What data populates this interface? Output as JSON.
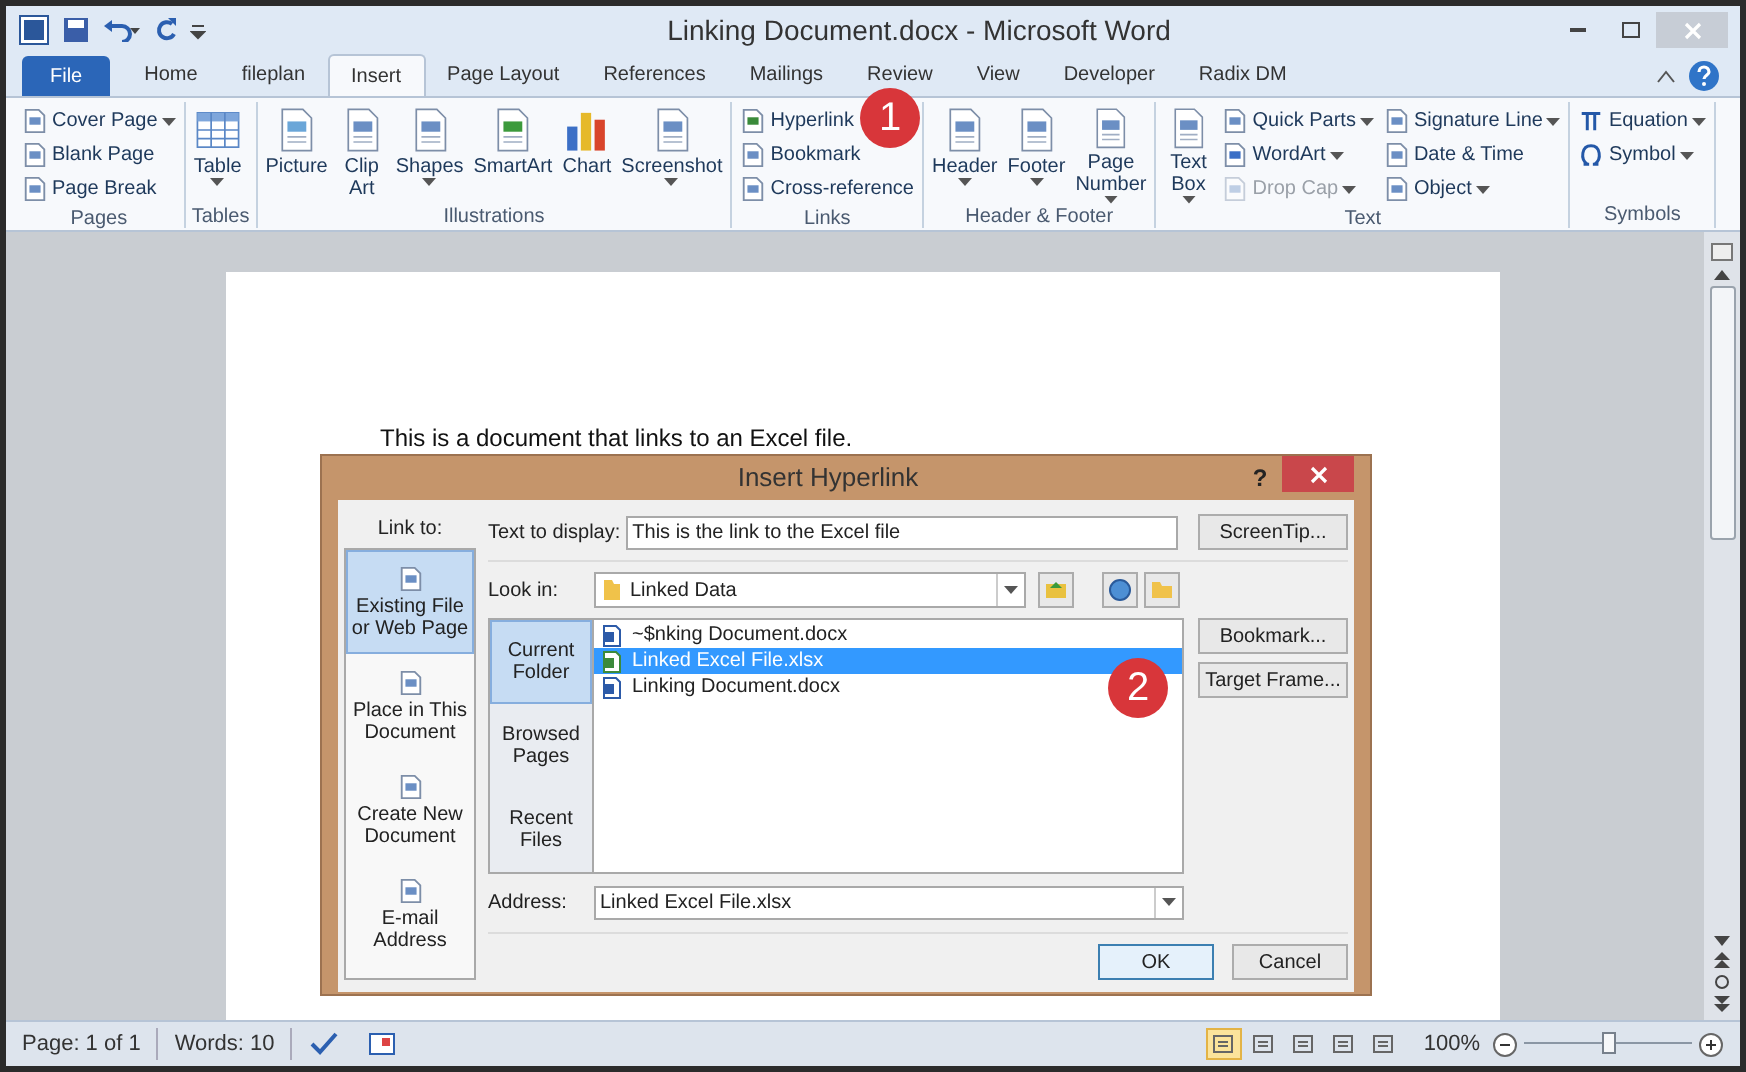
{
  "window": {
    "title": "Linking Document.docx - Microsoft Word"
  },
  "tabs": [
    {
      "label": "File",
      "kind": "file",
      "selected": false
    },
    {
      "label": "Home",
      "kind": "tab",
      "selected": false
    },
    {
      "label": "fileplan",
      "kind": "tab",
      "selected": false
    },
    {
      "label": "Insert",
      "kind": "tab",
      "selected": true
    },
    {
      "label": "Page Layout",
      "kind": "tab",
      "selected": false
    },
    {
      "label": "References",
      "kind": "tab",
      "selected": false
    },
    {
      "label": "Mailings",
      "kind": "tab",
      "selected": false
    },
    {
      "label": "Review",
      "kind": "tab",
      "selected": false
    },
    {
      "label": "View",
      "kind": "tab",
      "selected": false
    },
    {
      "label": "Developer",
      "kind": "tab",
      "selected": false
    },
    {
      "label": "Radix DM",
      "kind": "tab",
      "selected": false
    }
  ],
  "ribbon": [
    {
      "label": "Pages",
      "items": [
        {
          "kind": "small",
          "label": "Cover Page",
          "dropdown": true,
          "disabled": false
        },
        {
          "kind": "small",
          "label": "Blank Page",
          "dropdown": false,
          "disabled": false
        },
        {
          "kind": "small",
          "label": "Page Break",
          "dropdown": false,
          "disabled": false
        }
      ]
    },
    {
      "label": "Tables",
      "items": [
        {
          "kind": "large",
          "label": "Table",
          "dropdown": true,
          "disabled": false
        }
      ]
    },
    {
      "label": "Illustrations",
      "items": [
        {
          "kind": "large",
          "label": "Picture",
          "dropdown": false,
          "disabled": false
        },
        {
          "kind": "large",
          "label": "Clip\nArt",
          "dropdown": false,
          "disabled": false
        },
        {
          "kind": "large",
          "label": "Shapes",
          "dropdown": true,
          "disabled": false
        },
        {
          "kind": "large",
          "label": "SmartArt",
          "dropdown": false,
          "disabled": false
        },
        {
          "kind": "large",
          "label": "Chart",
          "dropdown": false,
          "disabled": false
        },
        {
          "kind": "large",
          "label": "Screenshot",
          "dropdown": true,
          "disabled": false
        }
      ]
    },
    {
      "label": "Links",
      "items": [
        {
          "kind": "small",
          "label": "Hyperlink",
          "dropdown": false,
          "disabled": false
        },
        {
          "kind": "small",
          "label": "Bookmark",
          "dropdown": false,
          "disabled": false
        },
        {
          "kind": "small",
          "label": "Cross-reference",
          "dropdown": false,
          "disabled": false
        }
      ]
    },
    {
      "label": "Header & Footer",
      "items": [
        {
          "kind": "large",
          "label": "Header",
          "dropdown": true,
          "disabled": false
        },
        {
          "kind": "large",
          "label": "Footer",
          "dropdown": true,
          "disabled": false
        },
        {
          "kind": "large",
          "label": "Page\nNumber",
          "dropdown": true,
          "disabled": false
        }
      ]
    },
    {
      "label": "Text",
      "items": [
        {
          "kind": "large",
          "label": "Text\nBox",
          "dropdown": true,
          "disabled": false
        },
        {
          "kind": "small",
          "label": "Quick Parts",
          "dropdown": true,
          "disabled": false
        },
        {
          "kind": "small",
          "label": "WordArt",
          "dropdown": true,
          "disabled": false
        },
        {
          "kind": "small",
          "label": "Drop Cap",
          "dropdown": true,
          "disabled": true
        },
        {
          "kind": "small",
          "label": "Signature Line",
          "dropdown": true,
          "disabled": false
        },
        {
          "kind": "small",
          "label": "Date & Time",
          "dropdown": false,
          "disabled": false
        },
        {
          "kind": "small",
          "label": "Object",
          "dropdown": true,
          "disabled": false
        }
      ]
    },
    {
      "label": "Symbols",
      "items": [
        {
          "kind": "small",
          "label": "Equation",
          "dropdown": true,
          "disabled": false
        },
        {
          "kind": "small",
          "label": "Symbol",
          "dropdown": true,
          "disabled": false
        }
      ]
    }
  ],
  "document": {
    "text": "This is a document that links to an Excel file."
  },
  "dialog": {
    "title": "Insert Hyperlink",
    "help": "?",
    "link_to_label": "Link to:",
    "link_to": [
      {
        "label": "Existing File or Web Page",
        "selected": true
      },
      {
        "label": "Place in This Document",
        "selected": false
      },
      {
        "label": "Create New Document",
        "selected": false
      },
      {
        "label": "E-mail Address",
        "selected": false
      }
    ],
    "text_to_display": {
      "label": "Text to display:",
      "value": "This is the link to the Excel file"
    },
    "look_in": {
      "label": "Look in:",
      "value": "Linked Data"
    },
    "sections": [
      {
        "label": "Current Folder",
        "selected": true
      },
      {
        "label": "Browsed Pages",
        "selected": false
      },
      {
        "label": "Recent Files",
        "selected": false
      }
    ],
    "files": [
      {
        "name": "~$nking Document.docx",
        "kind": "word",
        "selected": false
      },
      {
        "name": "Linked Excel File.xlsx",
        "kind": "excel",
        "selected": true
      },
      {
        "name": "Linking Document.docx",
        "kind": "word",
        "selected": false
      }
    ],
    "address": {
      "label": "Address:",
      "value": "Linked Excel File.xlsx"
    },
    "side_buttons": [
      "ScreenTip...",
      "Bookmark...",
      "Target Frame..."
    ],
    "ok": "OK",
    "cancel": "Cancel"
  },
  "callouts": [
    "1",
    "2"
  ],
  "status_bar": {
    "page": "Page: 1 of 1",
    "words": "Words: 10",
    "views": [
      {
        "selected": true
      },
      {
        "selected": false
      },
      {
        "selected": false
      },
      {
        "selected": false
      },
      {
        "selected": false
      }
    ],
    "zoom": "100%",
    "zoom_level": {
      "level": 0.5
    }
  }
}
